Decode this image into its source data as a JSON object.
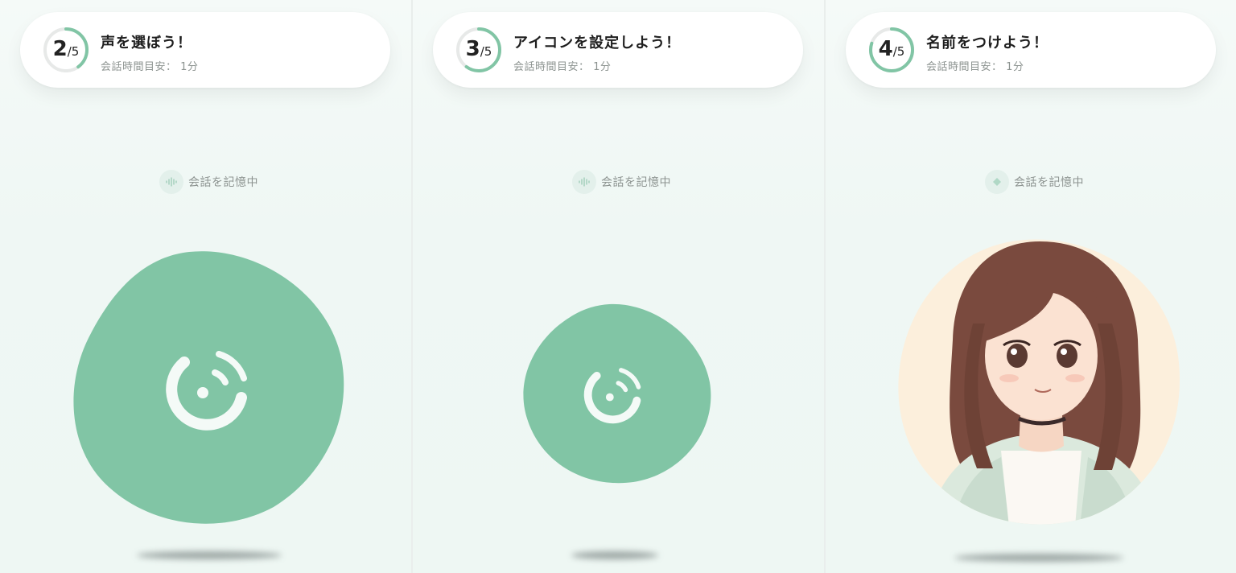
{
  "accent_color": "#81c5a5",
  "ring_track_color": "#e7e9e8",
  "panels": [
    {
      "step": {
        "current": "2",
        "total": "/5",
        "fraction": 0.4
      },
      "title": "声を選ぼう！",
      "subtitle": "会話時間目安： 1分",
      "status": {
        "icon": "waveform-icon",
        "label": "会話を記憶中"
      },
      "avatar": "assistant-logo-icon"
    },
    {
      "step": {
        "current": "3",
        "total": "/5",
        "fraction": 0.6
      },
      "title": "アイコンを設定しよう！",
      "subtitle": "会話時間目安： 1分",
      "status": {
        "icon": "waveform-icon",
        "label": "会話を記憶中"
      },
      "avatar": "assistant-logo-icon"
    },
    {
      "step": {
        "current": "4",
        "total": "/5",
        "fraction": 0.8
      },
      "title": "名前をつけよう！",
      "subtitle": "会話時間目安： 1分",
      "status": {
        "icon": "waveform-icon",
        "label": "会話を記憶中"
      },
      "avatar": "anime-girl-portrait"
    }
  ]
}
